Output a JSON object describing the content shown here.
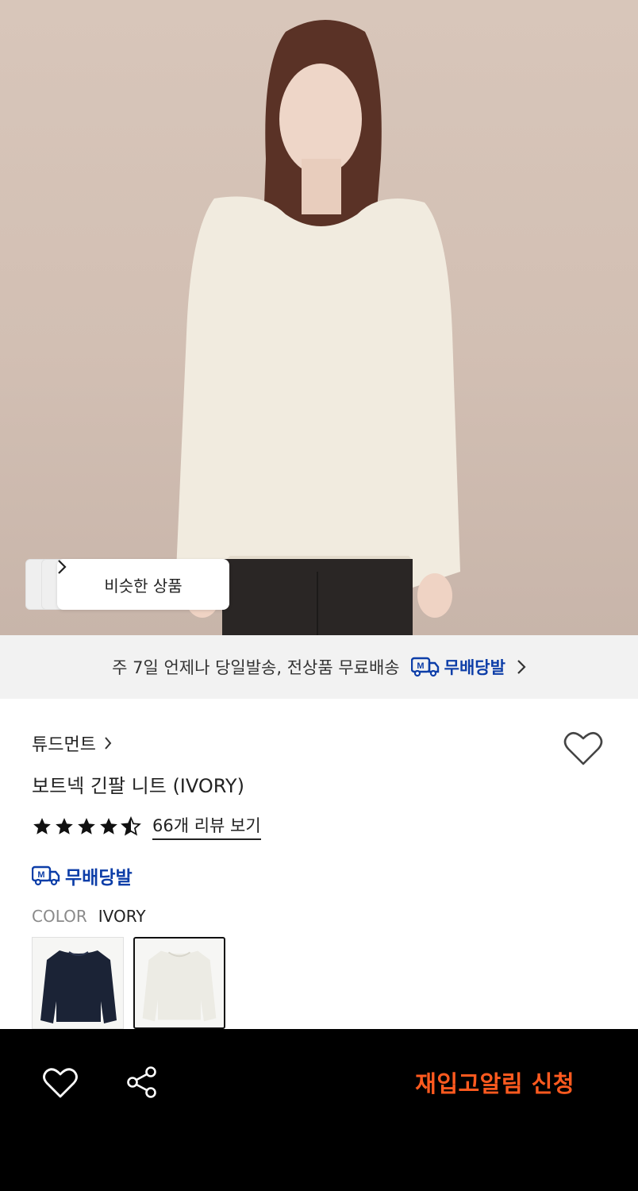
{
  "hero": {
    "similar_label": "비슷한 상품",
    "similar_chevron": "chevron-right-icon"
  },
  "shipping_banner": {
    "text": "주 7일 언제나 당일발송, 전상품 무료배송",
    "badge_label": "무배당발",
    "badge_icon": "truck-icon",
    "chevron_icon": "chevron-right-icon",
    "badge_color": "#0d3ea8"
  },
  "product": {
    "brand": "튜드먼트",
    "title": "보트넥 긴팔 니트 (IVORY)",
    "rating": 4.5,
    "review_link": "66개 리뷰 보기",
    "shipping_badge": "무배당발",
    "color_label": "COLOR",
    "color_value": "IVORY",
    "swatches": [
      {
        "name": "navy",
        "selected": false
      },
      {
        "name": "ivory",
        "selected": true
      }
    ]
  },
  "bottom_bar": {
    "wishlist_icon": "heart-icon",
    "share_icon": "share-icon",
    "cta_label": "재입고알림 신청",
    "cta_color": "#ff5a1f"
  }
}
